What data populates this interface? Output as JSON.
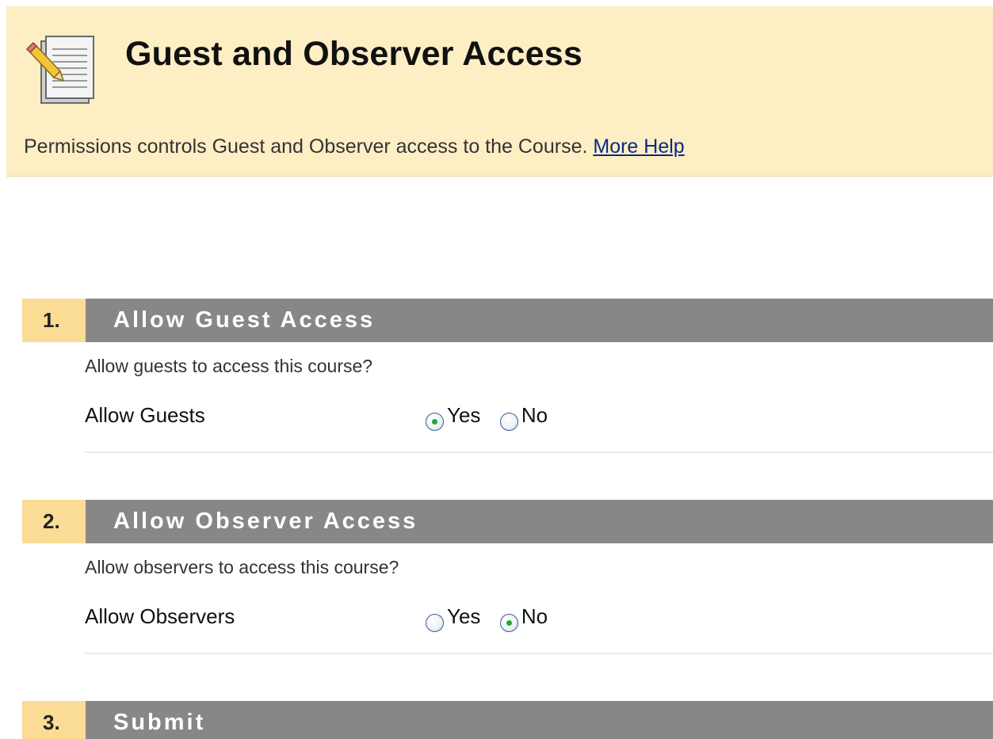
{
  "header": {
    "title": "Guest and Observer Access",
    "instructions": "Permissions controls Guest and Observer access to the Course.",
    "help_link": "More Help",
    "icon": "document-edit-icon"
  },
  "steps": [
    {
      "number": "1.",
      "title": "Allow Guest Access",
      "description": "Allow guests to access this course?",
      "field_label": "Allow Guests",
      "options": [
        "Yes",
        "No"
      ],
      "selected": "Yes"
    },
    {
      "number": "2.",
      "title": "Allow Observer Access",
      "description": "Allow observers to access this course?",
      "field_label": "Allow Observers",
      "options": [
        "Yes",
        "No"
      ],
      "selected": "No"
    },
    {
      "number": "3.",
      "title": "Submit"
    }
  ],
  "colors": {
    "header_bg": "#fdeec4",
    "step_number_bg": "#fbdc95",
    "step_title_bg": "#878787",
    "link": "#0a2a84",
    "radio_selected": "#23a633"
  }
}
